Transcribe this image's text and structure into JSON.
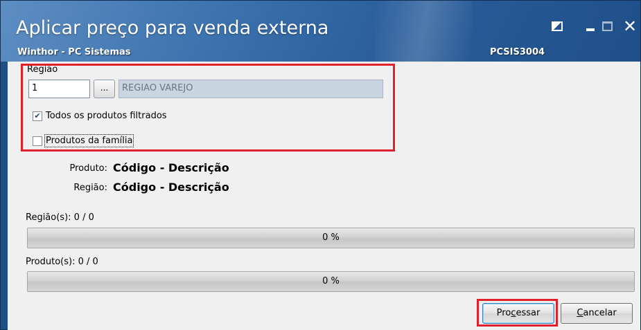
{
  "window": {
    "title": "Aplicar preço para venda externa",
    "subtitle": "Winthor - PC Sistemas",
    "code": "PCSIS3004"
  },
  "form": {
    "regiao_label": "Região",
    "regiao_code": "1",
    "browse_label": "...",
    "regiao_name": "REGIAO VAREJO",
    "todos_label": "Todos os produtos filtrados",
    "todos_checked": true,
    "familia_label": "Produtos da família",
    "familia_checked": false
  },
  "info": {
    "produto_key": "Produto:",
    "produto_value": "Código - Descrição",
    "regiao_key": "Região:",
    "regiao_value": "Código - Descrição"
  },
  "progress": {
    "regioes_label": "Região(s): 0 / 0",
    "regioes_percent_text": "0 %",
    "regioes_fraction": 0,
    "produtos_label": "Produto(s): 0 / 0",
    "produtos_percent_text": "0 %",
    "produtos_fraction": 0
  },
  "buttons": {
    "processar_prefix": "Pro",
    "processar_underlined": "c",
    "processar_suffix": "essar",
    "cancelar_underlined": "C",
    "cancelar_suffix": "ancelar"
  },
  "colors": {
    "titlebar": "#3b71ad",
    "highlight": "#e0202a",
    "readonly_field": "#c9d5e0"
  }
}
